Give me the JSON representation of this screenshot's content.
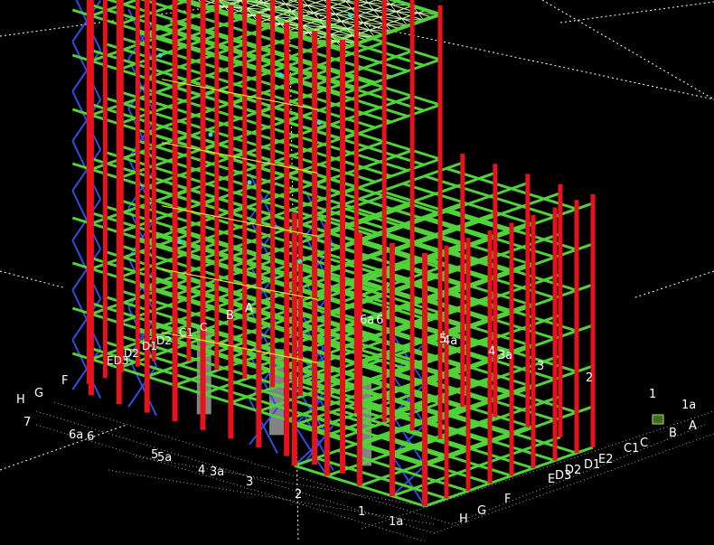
{
  "colors": {
    "background": "#000000",
    "column": "#e8121c",
    "beam": "#4fd23a",
    "bracing": "#2c4fe6",
    "roof_truss": "#b8f08a",
    "secondary": "#e8e23a",
    "highlight": "#2fe0d0",
    "core": "#9a9a9a",
    "grid_line": "#ffffff",
    "label": "#ffffff"
  },
  "left_axis_labels": [
    "F",
    "G",
    "H",
    "7",
    "6a",
    "6",
    "5",
    "5a",
    "4",
    "3a",
    "3",
    "2",
    "1",
    "1a"
  ],
  "right_axis_labels": [
    "H",
    "G",
    "F",
    "E",
    "D3",
    "D2",
    "D1",
    "E2",
    "C1",
    "C",
    "B",
    "A",
    "1",
    "1a",
    "2",
    "3",
    "4",
    "3a",
    "4a",
    "5"
  ],
  "interior_labels": [
    "ED3",
    "D2",
    "D1",
    "D2",
    "C1",
    "C",
    "B",
    "A",
    "6a",
    "6"
  ]
}
